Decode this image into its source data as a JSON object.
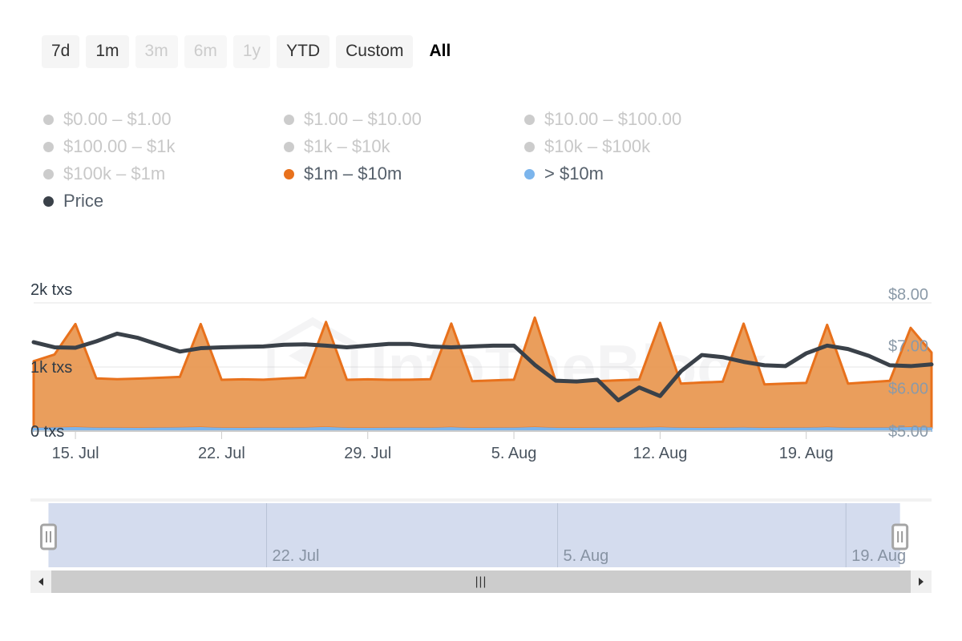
{
  "range_selector": {
    "buttons": [
      {
        "label": "7d",
        "state": "enabled"
      },
      {
        "label": "1m",
        "state": "enabled"
      },
      {
        "label": "3m",
        "state": "disabled"
      },
      {
        "label": "6m",
        "state": "disabled"
      },
      {
        "label": "1y",
        "state": "disabled"
      },
      {
        "label": "YTD",
        "state": "enabled"
      },
      {
        "label": "Custom",
        "state": "enabled"
      },
      {
        "label": "All",
        "state": "selected"
      }
    ]
  },
  "legend": {
    "items": [
      {
        "label": "$0.00 – $1.00",
        "color": "#cccccc",
        "active": false
      },
      {
        "label": "$1.00 – $10.00",
        "color": "#cccccc",
        "active": false
      },
      {
        "label": "$10.00 – $100.00",
        "color": "#cccccc",
        "active": false
      },
      {
        "label": "$100.00 – $1k",
        "color": "#cccccc",
        "active": false
      },
      {
        "label": "$1k – $10k",
        "color": "#cccccc",
        "active": false
      },
      {
        "label": "$10k – $100k",
        "color": "#cccccc",
        "active": false
      },
      {
        "label": "$100k – $1m",
        "color": "#cccccc",
        "active": false
      },
      {
        "label": "$1m – $10m",
        "color": "#e8711c",
        "active": true
      },
      {
        "label": "> $10m",
        "color": "#7cb5ec",
        "active": true
      },
      {
        "label": "Price",
        "color": "#3a4149",
        "active": true
      }
    ]
  },
  "watermark": {
    "text": "IntoTheBlock",
    "icon": "hexagon-logo-icon"
  },
  "chart_data": {
    "type": "area",
    "title": "",
    "xlabel": "",
    "ylabel": "txs",
    "y_left": {
      "ticks": [
        0,
        1000,
        2000
      ],
      "tick_labels": [
        "0 txs",
        "1k txs",
        "2k txs"
      ],
      "min": 0,
      "max": 2000
    },
    "y_right": {
      "ticks": [
        5,
        6,
        7,
        8
      ],
      "tick_labels": [
        "$5.00",
        "$6.00",
        "$7.00",
        "$8.00"
      ],
      "min": 5,
      "max": 8
    },
    "x_ticks": [
      "15. Jul",
      "22. Jul",
      "29. Jul",
      "5. Aug",
      "12. Aug",
      "19. Aug"
    ],
    "x_tick_index": [
      2,
      9,
      16,
      23,
      30,
      37
    ],
    "grid": true,
    "legend_position": "top",
    "series": [
      {
        "name": "$1m – $10m",
        "type": "area",
        "color": "#e8964e",
        "line_color": "#e8711c",
        "axis": "left",
        "values": [
          1050,
          1150,
          1620,
          780,
          770,
          780,
          790,
          800,
          1620,
          760,
          770,
          760,
          780,
          790,
          1650,
          760,
          770,
          760,
          760,
          770,
          1630,
          740,
          750,
          760,
          1720,
          740,
          750,
          740,
          750,
          760,
          1640,
          700,
          720,
          730,
          1630,
          690,
          700,
          710,
          1610,
          700,
          720,
          740,
          1560,
          1180
        ]
      },
      {
        "name": "> $10m",
        "type": "area",
        "color": "#7cb5ec",
        "line_color": "#7cb5ec",
        "axis": "left",
        "values": [
          40,
          45,
          50,
          42,
          40,
          38,
          42,
          45,
          50,
          40,
          38,
          42,
          40,
          44,
          52,
          40,
          38,
          40,
          42,
          40,
          48,
          38,
          40,
          42,
          50,
          40,
          38,
          40,
          42,
          44,
          48,
          40,
          38,
          40,
          46,
          38,
          40,
          42,
          48,
          40,
          42,
          44,
          50,
          45
        ]
      },
      {
        "name": "Price",
        "type": "line",
        "color": "#3a4149",
        "axis": "right",
        "values": [
          7.08,
          6.96,
          6.95,
          7.1,
          7.28,
          7.18,
          7.02,
          6.86,
          6.94,
          6.96,
          6.97,
          6.98,
          7.02,
          7.03,
          7.0,
          6.96,
          7.0,
          7.04,
          7.04,
          6.98,
          6.96,
          6.98,
          7.0,
          7.0,
          6.55,
          6.18,
          6.16,
          6.2,
          5.72,
          6.02,
          5.82,
          6.4,
          6.78,
          6.73,
          6.62,
          6.54,
          6.52,
          6.82,
          7.0,
          6.92,
          6.76,
          6.54,
          6.52,
          6.56
        ]
      }
    ]
  },
  "navigator": {
    "x_labels": [
      "22. Jul",
      "5. Aug",
      "19. Aug"
    ],
    "selection": {
      "start_pct": 2.0,
      "end_pct": 96.5
    },
    "handle_left": "navigator-handle-left",
    "handle_right": "navigator-handle-right",
    "mask_color": "#ccd6eb"
  },
  "scrollbar": {
    "left_arrow": "◀",
    "right_arrow": "▶",
    "grip": "|||",
    "thumb_start_pct": 0,
    "thumb_end_pct": 100
  },
  "colors": {
    "orange_fill": "#e8964e",
    "orange_line": "#e8711c",
    "blue": "#7cb5ec",
    "price_line": "#3a4149",
    "grid": "#e6e6e6",
    "axis_text_left": "#2f3b47",
    "axis_text_right": "#8b9aa8"
  }
}
